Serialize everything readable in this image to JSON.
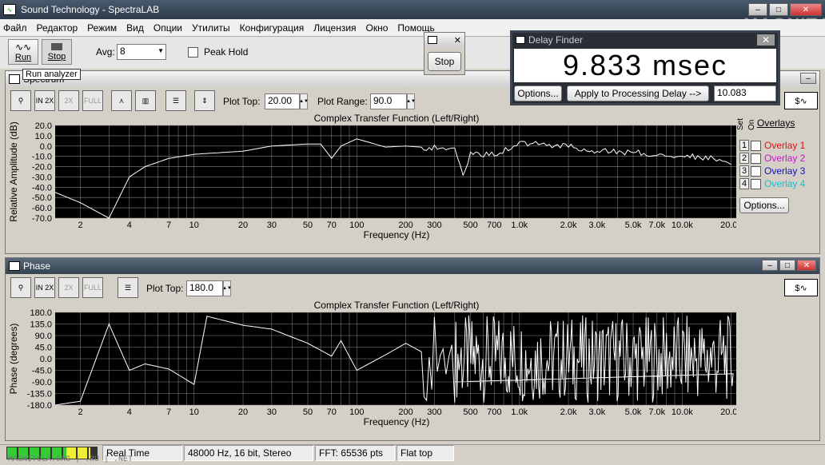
{
  "app": {
    "title": "Sound Technology - SpectraLAB"
  },
  "menu": [
    "Файл",
    "Редактор",
    "Режим",
    "Вид",
    "Опции",
    "Утилиты",
    "Конфигурация",
    "Лицензия",
    "Окно",
    "Помощь"
  ],
  "toolbar": {
    "run_label": "Run",
    "stop_label": "Stop",
    "avg_label": "Avg:",
    "avg_value": "8",
    "peak_hold_label": "Peak Hold",
    "tooltip": "Run analyzer"
  },
  "stop_window": {
    "stop_label": "Stop"
  },
  "delay_finder": {
    "title": "Delay Finder",
    "value": "9.833 msec",
    "options_label": "Options...",
    "apply_label": "Apply to Processing Delay -->",
    "apply_value": "10.083"
  },
  "spectrum": {
    "title": "Spectrum",
    "plot_top_label": "Plot Top:",
    "plot_top_value": "20.00",
    "plot_range_label": "Plot Range:",
    "plot_range_value": "90.0",
    "chart_title": "Complex Transfer Function (Left/Right)",
    "ylabel": "Relative Amplitude (dB)",
    "xlabel": "Frequency (Hz)",
    "yticks": [
      "20.0",
      "10.0",
      "0.0",
      "-10.0",
      "-20.0",
      "-30.0",
      "-40.0",
      "-50.0",
      "-60.0",
      "-70.0"
    ],
    "xticks": [
      "2",
      "4",
      "7",
      "10",
      "20",
      "30",
      "50",
      "70",
      "100",
      "200",
      "300",
      "500",
      "700",
      "1.0k",
      "2.0k",
      "3.0k",
      "5.0k",
      "7.0k",
      "10.0k",
      "20.0k"
    ],
    "overlays_title": "Overlays",
    "set_label": "Set",
    "on_label": "On",
    "overlays": [
      {
        "num": "1",
        "label": "Overlay 1",
        "color": "#e01010"
      },
      {
        "num": "2",
        "label": "Overlay 2",
        "color": "#d010d0"
      },
      {
        "num": "3",
        "label": "Overlay 3",
        "color": "#1010c0"
      },
      {
        "num": "4",
        "label": "Overlay 4",
        "color": "#10c0d0"
      }
    ],
    "overlay_options_label": "Options..."
  },
  "phase": {
    "title": "Phase",
    "plot_top_label": "Plot Top:",
    "plot_top_value": "180.0",
    "chart_title": "Complex Transfer Function (Left/Right)",
    "ylabel": "Phase (degrees)",
    "xlabel": "Frequency (Hz)",
    "yticks": [
      "180.0",
      "135.0",
      "90.0",
      "45.0",
      "0.0",
      "-45.0",
      "-90.0",
      "-135.0",
      "-180.0"
    ],
    "xticks": [
      "2",
      "4",
      "7",
      "10",
      "20",
      "30",
      "50",
      "70",
      "100",
      "200",
      "300",
      "500",
      "700",
      "1.0k",
      "2.0k",
      "3.0k",
      "5.0k",
      "7.0k",
      "10.0k",
      "20.0k"
    ]
  },
  "status": {
    "mode": "Real Time",
    "format": "48000 Hz, 16 bit, Stereo",
    "fft": "FFT: 65536 pts",
    "window": "Flat top"
  },
  "watermark": {
    "logo": "MAGNIT.I",
    "bottom": "MAGNITOLA.ORG | .RU | .NET"
  },
  "chart_data": [
    {
      "type": "line",
      "title": "Complex Transfer Function (Left/Right)",
      "xlabel": "Frequency (Hz)",
      "ylabel": "Relative Amplitude (dB)",
      "xscale": "log",
      "xlim": [
        1.4,
        22000
      ],
      "ylim": [
        -70,
        20
      ],
      "grid": true,
      "x": [
        1.4,
        2,
        3,
        4,
        5,
        7,
        10,
        20,
        30,
        50,
        60,
        70,
        80,
        100,
        150,
        200,
        300,
        400,
        450,
        500,
        700,
        1000,
        2000,
        3000,
        5000,
        7000,
        10000,
        15000,
        20000
      ],
      "y": [
        -45,
        -55,
        -70,
        -30,
        -20,
        -12,
        -8,
        -5,
        0,
        2,
        2,
        -12,
        0,
        7,
        -1,
        0,
        -2,
        -3,
        -30,
        -8,
        -8,
        3,
        0,
        -5,
        -6,
        -8,
        -9,
        -12,
        -18
      ]
    },
    {
      "type": "line",
      "title": "Complex Transfer Function (Left/Right)",
      "xlabel": "Frequency (Hz)",
      "ylabel": "Phase (degrees)",
      "xscale": "log",
      "xlim": [
        1.4,
        22000
      ],
      "ylim": [
        -180,
        180
      ],
      "grid": true,
      "x": [
        1.4,
        2,
        3,
        4,
        5,
        7,
        10,
        12,
        20,
        30,
        50,
        70,
        80,
        100,
        150,
        200,
        300,
        400
      ],
      "y": [
        -180,
        -165,
        135,
        -45,
        -20,
        -40,
        -100,
        165,
        130,
        115,
        60,
        10,
        70,
        -45,
        15,
        60,
        0,
        -90
      ]
    }
  ]
}
